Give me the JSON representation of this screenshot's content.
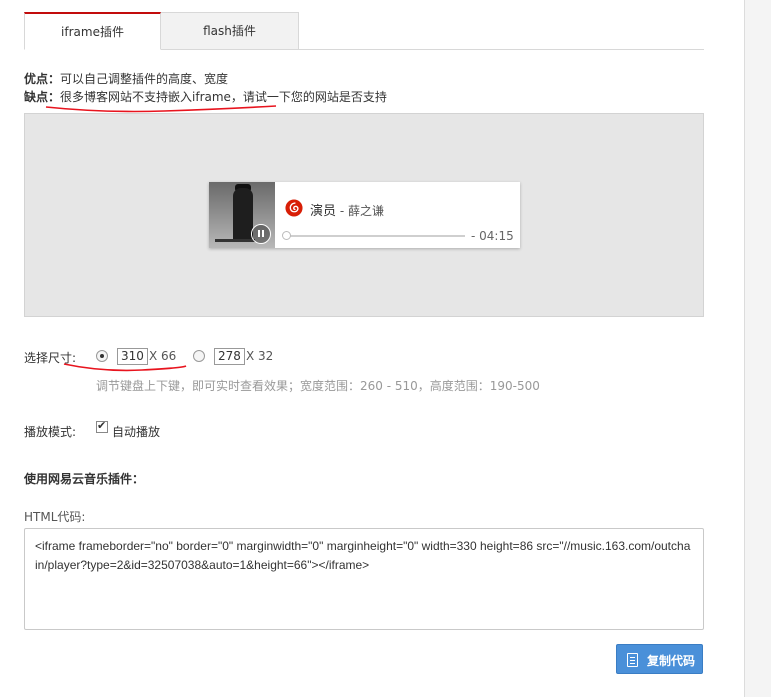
{
  "tabs": [
    {
      "label": "iframe插件",
      "active": true
    },
    {
      "label": "flash插件",
      "active": false
    }
  ],
  "info": {
    "pros_label": "优点：",
    "pros_text": "可以自己调整插件的高度、宽度",
    "cons_label": "缺点：",
    "cons_text": "很多博客网站不支持嵌入iframe，请试一下您的网站是否支持"
  },
  "player": {
    "song": "演员",
    "separator": " - ",
    "artist": "薛之谦",
    "time": "- 04:15",
    "progress": 0,
    "state": "playing"
  },
  "size": {
    "label": "选择尺寸:",
    "option1_width": "310",
    "option1_height": "X 66",
    "option2_width": "278",
    "option2_height": "X 32",
    "selected": "310",
    "hint": "调节键盘上下键，即可实时查看效果；宽度范围：260 - 510，高度范围：190-500"
  },
  "play_mode": {
    "label": "播放模式:",
    "autoplay_label": "自动播放",
    "autoplay_checked": true
  },
  "plugin": {
    "title": "使用网易云音乐插件：",
    "html_label": "HTML代码:",
    "code": "<iframe frameborder=\"no\" border=\"0\" marginwidth=\"0\" marginheight=\"0\" width=330 height=86 src=\"//music.163.com/outchain/player?type=2&id=32507038&auto=1&height=66\"></iframe>",
    "copy_label": "复制代码"
  },
  "colors": {
    "accent_red": "#c20c0c",
    "button_blue": "#4a90d9",
    "annotation_red": "#e8141e"
  }
}
